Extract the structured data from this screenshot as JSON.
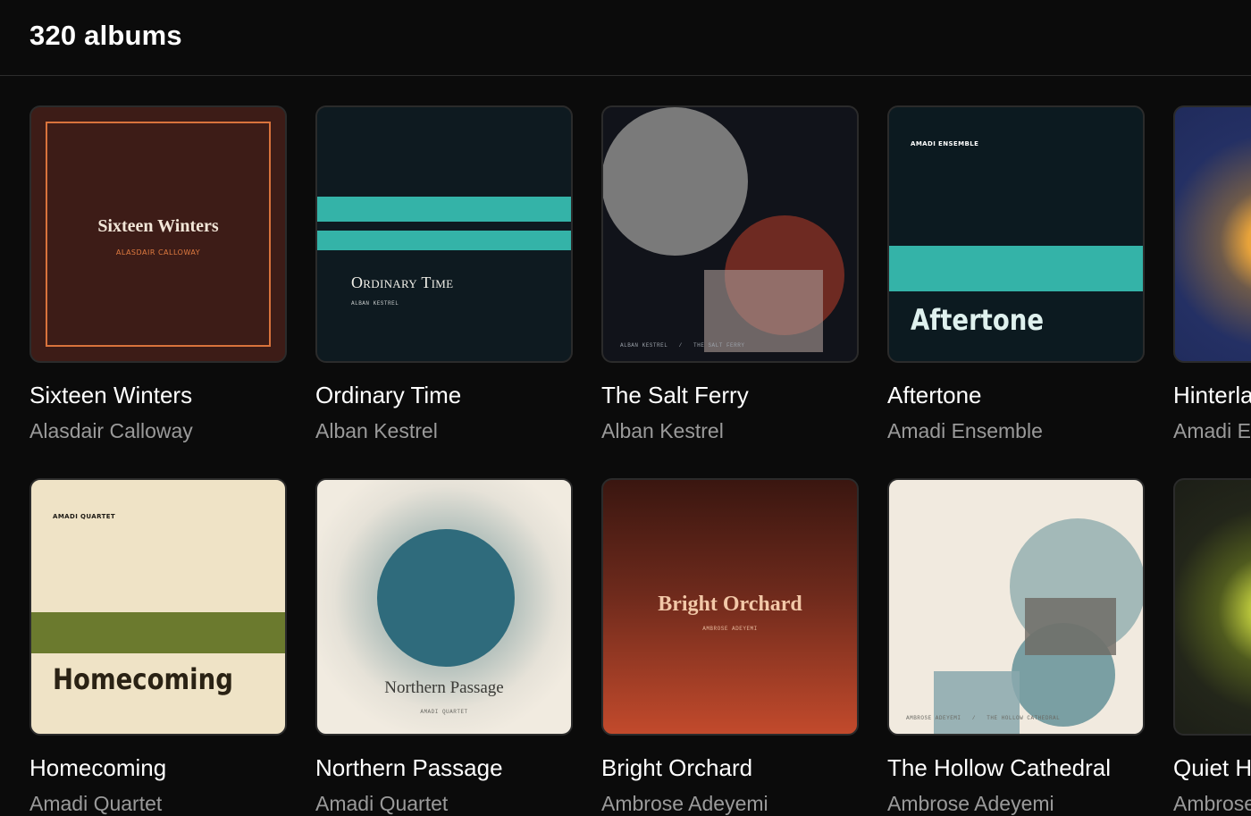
{
  "header": {
    "title": "320 albums"
  },
  "albums": [
    {
      "title": "Sixteen Winters",
      "artist": "Alasdair Calloway",
      "cover": {
        "title": "Sixteen Winters",
        "subtitle": "ALASDAIR CALLOWAY"
      },
      "colors": {
        "bg": "#3d1c17",
        "frame": "#d9733c"
      }
    },
    {
      "title": "Ordinary Time",
      "artist": "Alban Kestrel",
      "cover": {
        "title": "Ordinary Time",
        "subtitle": "ALBAN KESTREL"
      },
      "colors": {
        "bg": "#0e1a20",
        "stripe": "#34b3a8"
      }
    },
    {
      "title": "The Salt Ferry",
      "artist": "Alban Kestrel",
      "cover": {
        "caption_left": "ALBAN KESTREL",
        "caption_sep": "/",
        "caption_right": "THE SALT FERRY"
      },
      "colors": {
        "bg": "#11131a",
        "circle1": "#7a7a7a",
        "circle2": "#6e2a22",
        "rect": "#a89894"
      }
    },
    {
      "title": "Aftertone",
      "artist": "Amadi Ensemble",
      "cover": {
        "label": "AMADI ENSEMBLE",
        "title": "Aftertone"
      },
      "colors": {
        "bg": "#0c1a20",
        "band": "#34b3a8"
      }
    },
    {
      "title": "Hinterland",
      "artist": "Amadi Ensemble",
      "colors": {
        "bg": "#1f2a5a",
        "glow": "#e8a33a"
      }
    },
    {
      "title": "Homecoming",
      "artist": "Amadi Quartet",
      "cover": {
        "label": "AMADI QUARTET",
        "title": "Homecoming"
      },
      "colors": {
        "bg": "#efe3c6",
        "band": "#6b7a2e"
      }
    },
    {
      "title": "Northern Passage",
      "artist": "Amadi Quartet",
      "cover": {
        "title": "Northern Passage",
        "subtitle": "AMADI QUARTET"
      },
      "colors": {
        "bg": "#f1ebe0",
        "circle": "#2f6b7c"
      }
    },
    {
      "title": "Bright Orchard",
      "artist": "Ambrose Adeyemi",
      "cover": {
        "title": "Bright Orchard",
        "subtitle": "AMBROSE ADEYEMI"
      },
      "colors": {
        "top": "#3a1610",
        "bottom": "#c24a2c"
      }
    },
    {
      "title": "The Hollow Cathedral",
      "artist": "Ambrose Adeyemi",
      "cover": {
        "caption_left": "AMBROSE ADEYEMI",
        "caption_sep": "/",
        "caption_right": "THE HOLLOW CATHEDRAL"
      },
      "colors": {
        "bg": "#f1eadf",
        "circle": "#a3b9b8",
        "circle2": "#7a9fa3",
        "rect": "#6e6a64"
      }
    },
    {
      "title": "Quiet Hours",
      "artist": "Ambrose Adeyemi",
      "colors": {
        "bg": "#1a1c16",
        "glow": "#b5c23a"
      }
    }
  ]
}
